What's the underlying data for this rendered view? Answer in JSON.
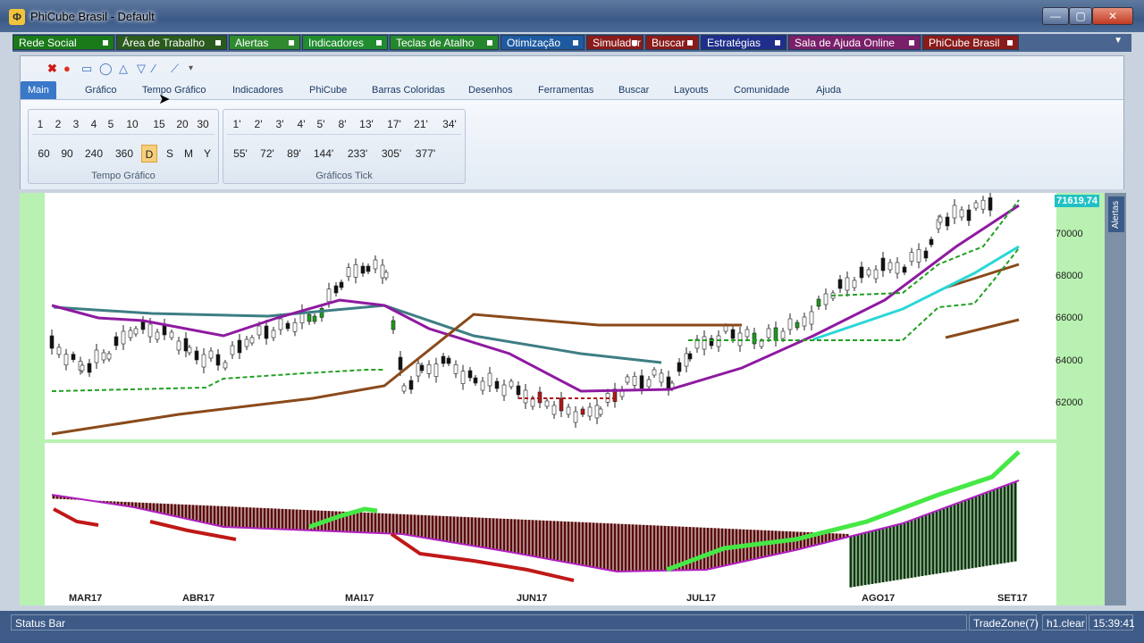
{
  "window": {
    "title": "PhiCube Brasil - Default",
    "icon": "phicube-logo-icon",
    "minimize": "—",
    "maximize": "▢",
    "close": "✕"
  },
  "top_tabs": [
    {
      "label": "Rede Social",
      "color": "#1a7a1a"
    },
    {
      "label": "Área de Trabalho",
      "color": "#2a5a1c"
    },
    {
      "label": "Alertas",
      "color": "#2f8a2f"
    },
    {
      "label": "Indicadores",
      "color": "#1f8c2f"
    },
    {
      "label": "Teclas de Atalho",
      "color": "#25872d"
    },
    {
      "label": "Otimização",
      "color": "#1d5aa0"
    },
    {
      "label": "Simulador",
      "color": "#8a1b1b"
    },
    {
      "label": "Buscar",
      "color": "#8a1b1b"
    },
    {
      "label": "Estratégias",
      "color": "#1e2e8a"
    },
    {
      "label": "Sala de Ajuda Online",
      "color": "#7a1f6a"
    },
    {
      "label": "PhiCube Brasil",
      "color": "#8a1b1b"
    }
  ],
  "ribbon_tabs": [
    "Main",
    "Gráfico",
    "Tempo Gráfico",
    "Indicadores",
    "PhiCube",
    "Barras Coloridas",
    "Desenhos",
    "Ferramentas",
    "Buscar",
    "Layouts",
    "Comunidade",
    "Ajuda"
  ],
  "tempo_grafico": {
    "label": "Tempo Gráfico",
    "row1": [
      "1",
      "2",
      "3",
      "4",
      "5",
      "10",
      "15",
      "20",
      "30"
    ],
    "row2": [
      "60",
      "90",
      "240",
      "360",
      "D",
      "S",
      "M",
      "Y"
    ],
    "selected": "D"
  },
  "graficos_tick": {
    "label": "Gráficos Tick",
    "row1": [
      "1'",
      "2'",
      "3'",
      "4'",
      "5'",
      "8'",
      "13'",
      "17'",
      "21'",
      "34'"
    ],
    "row2": [
      "55'",
      "72'",
      "89'",
      "144'",
      "233'",
      "305'",
      "377'"
    ]
  },
  "chart": {
    "last_price": "71619,74",
    "y_ticks": [
      "70000",
      "68000",
      "66000",
      "64000",
      "62000"
    ],
    "x_ticks": [
      "MAR17",
      "ABR17",
      "MAI17",
      "JUN17",
      "JUL17",
      "AGO17",
      "SET17"
    ],
    "side_tab": "Alertas"
  },
  "status": {
    "left": "Status Bar",
    "tradezone": "TradeZone(7)",
    "clear": "h1.clear",
    "time": "15:39:41"
  }
}
